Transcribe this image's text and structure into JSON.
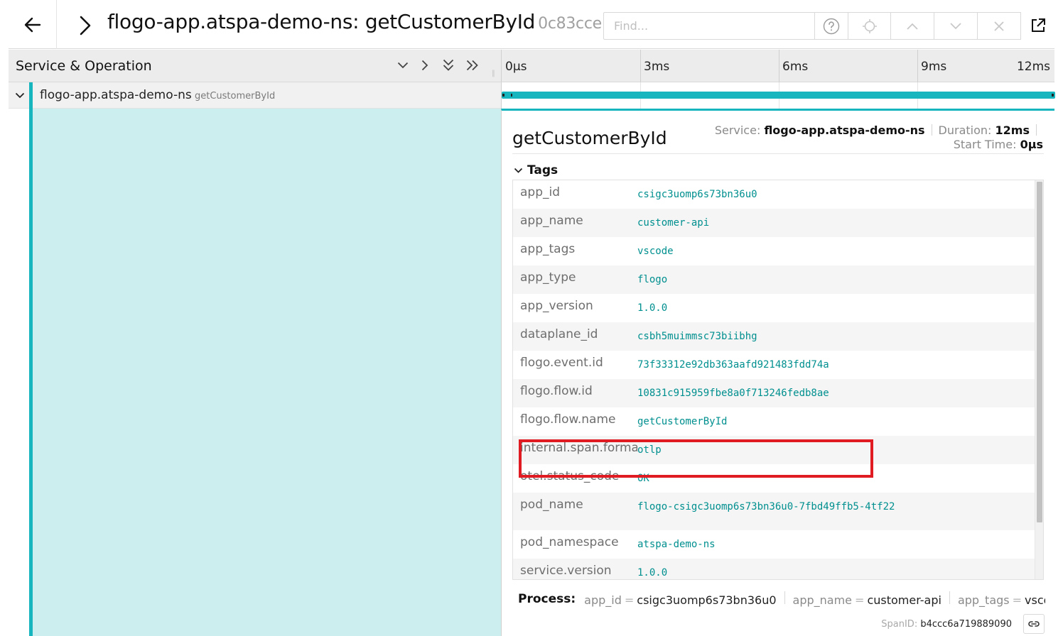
{
  "header": {
    "trace_title": "flogo-app.atspa-demo-ns: getCustomerById",
    "trace_id": "0c83cce",
    "find_placeholder": "Find...",
    "icons": [
      "arrow-left-icon",
      "chevron-right-icon",
      "question-circle-icon",
      "crosshair-icon",
      "chevron-up-icon",
      "chevron-down-icon",
      "close-icon",
      "external-link-icon"
    ]
  },
  "left_panel": {
    "title": "Service & Operation",
    "controls": [
      "chevron-down-icon",
      "chevron-right-icon",
      "double-chevron-down-icon",
      "double-chevron-right-icon"
    ],
    "span": {
      "service": "flogo-app.atspa-demo-ns",
      "operation": "getCustomerById"
    }
  },
  "timeline": {
    "ticks": [
      "0µs",
      "3ms",
      "6ms",
      "9ms",
      "12ms"
    ]
  },
  "detail": {
    "operation": "getCustomerById",
    "service_label": "Service:",
    "service_value": "flogo-app.atspa-demo-ns",
    "duration_label": "Duration:",
    "duration_value": "12ms",
    "start_label": "Start Time:",
    "start_value": "0µs",
    "tags_title": "Tags",
    "tags": [
      {
        "key": "app_id",
        "value": "csigc3uomp6s73bn36u0"
      },
      {
        "key": "app_name",
        "value": "customer-api"
      },
      {
        "key": "app_tags",
        "value": "vscode"
      },
      {
        "key": "app_type",
        "value": "flogo"
      },
      {
        "key": "app_version",
        "value": "1.0.0"
      },
      {
        "key": "dataplane_id",
        "value": "csbh5muimmsc73biibhg"
      },
      {
        "key": "flogo.event.id",
        "value": "73f33312e92db363aafd921483fdd74a"
      },
      {
        "key": "flogo.flow.id",
        "value": "10831c915959fbe8a0f713246fedb8ae"
      },
      {
        "key": "flogo.flow.name",
        "value": "getCustomerById"
      },
      {
        "key": "internal.span.format",
        "value": "otlp"
      },
      {
        "key": "otel.status_code",
        "value": "OK"
      },
      {
        "key": "pod_name",
        "value": "flogo-csigc3uomp6s73bn36u0-7fbd49ffb5-4tf22"
      },
      {
        "key": "pod_namespace",
        "value": "atspa-demo-ns"
      },
      {
        "key": "service.version",
        "value": "1.0.0"
      }
    ],
    "process_title": "Process:",
    "process": [
      {
        "key": "app_id",
        "value": "csigc3uomp6s73bn36u0"
      },
      {
        "key": "app_name",
        "value": "customer-api"
      },
      {
        "key": "app_tags",
        "value": "vsco..."
      }
    ],
    "span_id_label": "SpanID:",
    "span_id_value": "b4ccc6a719889090"
  },
  "colors": {
    "accent": "#17b5be",
    "span_fill": "#cdeeee",
    "tag_value": "#008f8f",
    "highlight": "#e01b22"
  }
}
